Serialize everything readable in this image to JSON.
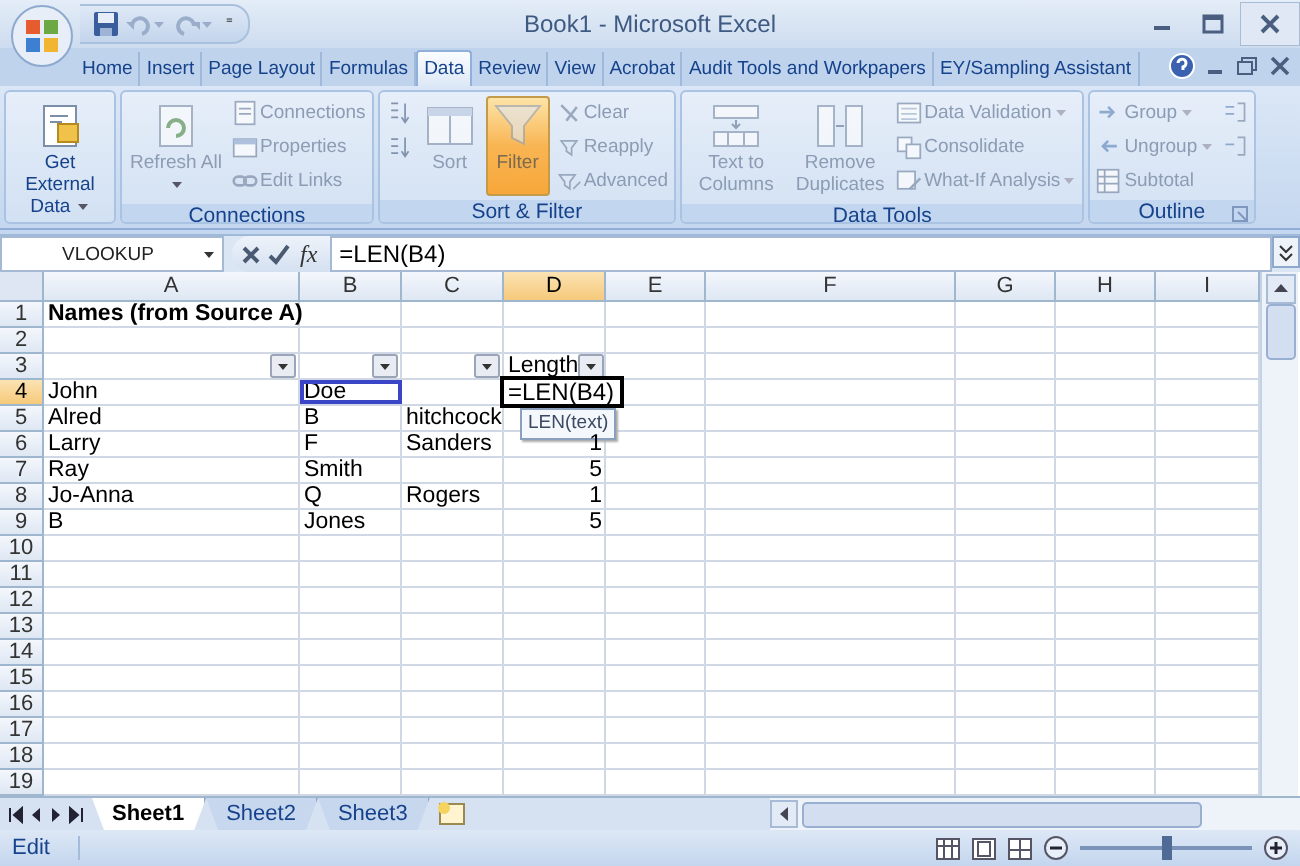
{
  "title_bar": {
    "title": "Book1 - Microsoft Excel",
    "quick_access": {
      "customize": "⁼"
    }
  },
  "ribbon_tabs": [
    {
      "label": "Home",
      "selected": false
    },
    {
      "label": "Insert",
      "selected": false
    },
    {
      "label": "Page Layout",
      "selected": false
    },
    {
      "label": "Formulas",
      "selected": false
    },
    {
      "label": "Data",
      "selected": true
    },
    {
      "label": "Review",
      "selected": false
    },
    {
      "label": "View",
      "selected": false
    },
    {
      "label": "Acrobat",
      "selected": false
    },
    {
      "label": "Audit Tools and Workpapers",
      "selected": false
    },
    {
      "label": "EY/Sampling Assistant",
      "selected": false
    }
  ],
  "ribbon_groups": [
    {
      "columns": [
        {
          "kind": "large",
          "label": "Get External Data",
          "dropdown": true,
          "disabled": false,
          "on": false
        }
      ]
    },
    {
      "label": "Connections",
      "columns": [
        {
          "kind": "large",
          "label": "Refresh All",
          "dropdown": true,
          "disabled": true,
          "on": false
        },
        {
          "kind": "stack",
          "items": [
            {
              "label": "Connections",
              "disabled": true,
              "on": false
            },
            {
              "label": "Properties",
              "disabled": true,
              "on": false
            },
            {
              "label": "Edit Links",
              "disabled": true,
              "on": false
            }
          ]
        }
      ]
    },
    {
      "label": "Sort & Filter",
      "columns": [
        {
          "kind": "stack",
          "items": [
            {
              "disabled": true,
              "on": false
            },
            {
              "disabled": true,
              "on": false
            }
          ]
        },
        {
          "kind": "large",
          "label": "Sort",
          "disabled": true,
          "on": false
        },
        {
          "kind": "large",
          "label": "Filter",
          "disabled": true,
          "on": true
        },
        {
          "kind": "stack",
          "items": [
            {
              "label": "Clear",
              "disabled": true,
              "on": false
            },
            {
              "label": "Reapply",
              "disabled": true,
              "on": false
            },
            {
              "label": "Advanced",
              "disabled": true,
              "on": false
            }
          ]
        }
      ]
    },
    {
      "label": "Data Tools",
      "columns": [
        {
          "kind": "large",
          "label": "Text to Columns",
          "disabled": true,
          "on": false
        },
        {
          "kind": "large",
          "label": "Remove Duplicates",
          "disabled": true,
          "on": false
        },
        {
          "kind": "stack",
          "items": [
            {
              "label": "Data Validation",
              "dropdown": true,
              "disabled": true,
              "on": false
            },
            {
              "label": "Consolidate",
              "disabled": true,
              "on": false
            },
            {
              "label": "What-If Analysis",
              "dropdown": true,
              "disabled": true,
              "on": false
            }
          ]
        }
      ]
    },
    {
      "label": "Outline",
      "launcher": true,
      "columns": [
        {
          "kind": "stack",
          "items": [
            {
              "label": "Group",
              "dropdown": true,
              "disabled": true,
              "on": false
            },
            {
              "label": "Ungroup",
              "dropdown": true,
              "disabled": true,
              "on": false
            },
            {
              "label": "Subtotal",
              "disabled": true,
              "on": false
            }
          ]
        },
        {
          "kind": "stack",
          "items": [
            {
              "disabled": true,
              "on": false
            },
            {
              "disabled": true,
              "on": false
            }
          ]
        }
      ]
    }
  ],
  "formula_bar": {
    "name_box": "VLOOKUP",
    "function_label": "fx",
    "formula": "=LEN(B4)"
  },
  "columns": [
    {
      "label": "A",
      "selected": false
    },
    {
      "label": "B",
      "selected": false
    },
    {
      "label": "C",
      "selected": false
    },
    {
      "label": "D",
      "selected": true
    },
    {
      "label": "E",
      "selected": false
    },
    {
      "label": "F",
      "selected": false
    },
    {
      "label": "G",
      "selected": false
    },
    {
      "label": "H",
      "selected": false
    },
    {
      "label": "I",
      "selected": false
    }
  ],
  "rows": [
    {
      "header": "1",
      "selected": false,
      "cells": [
        {
          "text": "Names (from Source A)",
          "bold": true
        }
      ]
    },
    {
      "header": "2",
      "selected": false
    },
    {
      "header": "3",
      "selected": false,
      "cells": [
        {
          "filter": true
        },
        {
          "filter": true
        },
        {
          "filter": true
        },
        {
          "text": "Length",
          "filter": true
        }
      ]
    },
    {
      "header": "4",
      "selected": true,
      "cells": [
        {
          "text": "John"
        },
        {
          "text": "Doe",
          "range_highlight": true
        },
        null,
        {
          "text": "=LEN(B4)",
          "editing": true,
          "tooltip": "LEN(text)"
        }
      ]
    },
    {
      "header": "5",
      "selected": false,
      "cells": [
        {
          "text": "Alred"
        },
        {
          "text": "B"
        },
        {
          "text": "hitchcock"
        }
      ]
    },
    {
      "header": "6",
      "selected": false,
      "cells": [
        {
          "text": "Larry"
        },
        {
          "text": "F"
        },
        {
          "text": "Sanders"
        },
        {
          "text": "1",
          "kind": "number"
        }
      ]
    },
    {
      "header": "7",
      "selected": false,
      "cells": [
        {
          "text": "Ray"
        },
        {
          "text": "Smith"
        },
        null,
        {
          "text": "5",
          "kind": "number"
        }
      ]
    },
    {
      "header": "8",
      "selected": false,
      "cells": [
        {
          "text": "Jo-Anna"
        },
        {
          "text": "Q"
        },
        {
          "text": "Rogers"
        },
        {
          "text": "1",
          "kind": "number"
        }
      ]
    },
    {
      "header": "9",
      "selected": false,
      "cells": [
        {
          "text": "B"
        },
        {
          "text": "Jones"
        },
        null,
        {
          "text": "5",
          "kind": "number"
        }
      ]
    },
    {
      "header": "10",
      "selected": false
    },
    {
      "header": "11",
      "selected": false
    },
    {
      "header": "12",
      "selected": false
    },
    {
      "header": "13",
      "selected": false
    },
    {
      "header": "14",
      "selected": false
    },
    {
      "header": "15",
      "selected": false
    },
    {
      "header": "16",
      "selected": false
    },
    {
      "header": "17",
      "selected": false
    },
    {
      "header": "18",
      "selected": false
    },
    {
      "header": "19",
      "selected": false
    }
  ],
  "sheet_tabs": [
    {
      "label": "Sheet1",
      "selected": true
    },
    {
      "label": "Sheet2",
      "selected": false
    },
    {
      "label": "Sheet3",
      "selected": false
    }
  ],
  "status_bar": {
    "mode": "Edit",
    "zoom": {
      "level": 0.5
    }
  }
}
